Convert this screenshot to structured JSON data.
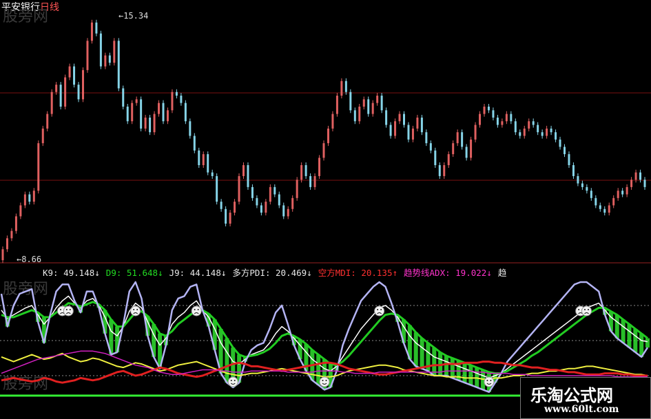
{
  "header": {
    "stock": "平安银行",
    "period": "日线"
  },
  "watermark": "股旁网",
  "price_labels": {
    "max": "15.34",
    "min": "8.66"
  },
  "indicators": [
    {
      "label": "K9: 49.148↓",
      "color": "#e8e8e8"
    },
    {
      "label": "D9: 51.648↓",
      "color": "#22dd22"
    },
    {
      "label": "J9: 44.148↓",
      "color": "#e8e8e8"
    },
    {
      "label": "多方PDI: 20.469↓",
      "color": "#e8e8e8"
    },
    {
      "label": "空方MDI: 20.135↑",
      "color": "#ff3030"
    },
    {
      "label": "趋势线ADX: 19.022↓",
      "color": "#ff33cc"
    },
    {
      "label": "趋",
      "color": "#e8e8e8"
    }
  ],
  "brand": {
    "name": "乐淘公式网",
    "url": "www.60lt.com"
  },
  "colors": {
    "up": "#e06060",
    "down": "#86d4e8",
    "grid": "#7a1010",
    "k": "#ffffff",
    "d": "#22cc22",
    "j": "#b4b4f4",
    "pdi": "#f0f040",
    "mdi": "#e02020",
    "adx": "#d020c0",
    "fill": "#33ee33"
  },
  "chart_data": [
    {
      "type": "candlestick",
      "title": "平安银行 日线",
      "ylim": [
        8.66,
        15.34
      ],
      "annotations": [
        "15.34",
        "8.66"
      ],
      "close": [
        8.9,
        9.2,
        9.4,
        9.8,
        10.1,
        10.4,
        10.2,
        10.5,
        11.8,
        12.2,
        12.6,
        13.2,
        13.4,
        12.8,
        13.6,
        13.9,
        13.4,
        13.0,
        13.8,
        14.6,
        15.1,
        14.8,
        13.9,
        14.2,
        14.0,
        14.6,
        13.3,
        12.8,
        12.4,
        12.9,
        13.0,
        12.2,
        12.5,
        12.1,
        12.6,
        12.9,
        12.4,
        12.7,
        13.2,
        13.1,
        12.9,
        12.4,
        12.0,
        11.6,
        11.2,
        11.5,
        11.0,
        10.9,
        10.2,
        10.0,
        9.6,
        9.9,
        10.2,
        10.9,
        11.2,
        10.6,
        10.3,
        10.1,
        9.9,
        10.2,
        10.6,
        10.4,
        10.1,
        9.8,
        10.0,
        10.3,
        10.8,
        11.2,
        10.9,
        10.6,
        10.9,
        11.4,
        11.8,
        12.2,
        12.6,
        13.1,
        13.5,
        13.2,
        12.7,
        12.4,
        12.8,
        13.0,
        12.6,
        12.9,
        13.1,
        12.7,
        12.3,
        12.0,
        12.4,
        12.6,
        12.3,
        11.9,
        12.2,
        12.5,
        12.1,
        11.8,
        11.6,
        11.2,
        10.9,
        11.2,
        11.5,
        11.8,
        12.1,
        11.7,
        11.4,
        11.9,
        12.3,
        12.6,
        12.8,
        12.7,
        12.5,
        12.3,
        12.4,
        12.6,
        12.4,
        12.1,
        12.0,
        12.2,
        12.4,
        12.3,
        12.1,
        12.0,
        12.2,
        12.1,
        11.9,
        11.7,
        11.5,
        11.2,
        10.9,
        10.7,
        10.6,
        10.5,
        10.3,
        10.1,
        10.0,
        9.9,
        10.1,
        10.3,
        10.5,
        10.4,
        10.6,
        10.8,
        11.0,
        10.8,
        10.6
      ]
    },
    {
      "type": "line",
      "series": [
        {
          "name": "K9",
          "values": [
            76,
            69,
            72,
            75,
            78,
            80,
            72,
            64,
            70,
            78,
            84,
            88,
            82,
            78,
            84,
            86,
            80,
            70,
            58,
            54,
            62,
            75,
            82,
            78,
            66,
            55,
            46,
            52,
            64,
            70,
            74,
            80,
            84,
            76,
            70,
            60,
            48,
            40,
            32,
            30,
            34,
            38,
            40,
            42,
            48,
            56,
            62,
            58,
            52,
            46,
            40,
            34,
            30,
            26,
            24,
            28,
            36,
            44,
            52,
            60,
            66,
            72,
            78,
            80,
            76,
            70,
            62,
            54,
            48,
            44,
            40,
            36,
            34,
            32,
            30,
            28,
            26,
            24,
            22,
            20,
            18,
            20,
            22,
            26,
            30,
            34,
            38,
            42,
            46,
            50,
            54,
            58,
            62,
            66,
            70,
            74,
            78,
            80,
            82,
            76,
            70,
            66,
            62,
            58,
            54,
            50,
            49
          ]
        },
        {
          "name": "D9",
          "values": [
            72,
            70,
            70,
            72,
            74,
            76,
            74,
            70,
            70,
            74,
            78,
            82,
            81,
            79,
            81,
            83,
            81,
            76,
            68,
            62,
            62,
            68,
            74,
            75,
            71,
            64,
            56,
            54,
            58,
            64,
            68,
            72,
            76,
            76,
            73,
            68,
            60,
            52,
            44,
            38,
            36,
            37,
            38,
            40,
            43,
            48,
            54,
            56,
            54,
            51,
            47,
            42,
            38,
            34,
            30,
            29,
            32,
            37,
            43,
            49,
            55,
            61,
            67,
            72,
            73,
            72,
            68,
            63,
            57,
            52,
            48,
            44,
            40,
            37,
            35,
            33,
            31,
            29,
            27,
            25,
            23,
            22,
            22,
            24,
            27,
            30,
            33,
            37,
            40,
            44,
            48,
            52,
            56,
            60,
            64,
            68,
            72,
            75,
            78,
            78,
            75,
            72,
            68,
            64,
            60,
            56,
            52
          ]
        },
        {
          "name": "J9",
          "values": [
            90,
            62,
            80,
            90,
            92,
            94,
            66,
            48,
            72,
            92,
            98,
            98,
            84,
            74,
            92,
            92,
            78,
            56,
            38,
            40,
            64,
            92,
            100,
            86,
            54,
            36,
            26,
            46,
            76,
            86,
            88,
            96,
            98,
            76,
            62,
            42,
            22,
            14,
            10,
            14,
            32,
            42,
            46,
            48,
            60,
            74,
            80,
            64,
            46,
            34,
            24,
            16,
            12,
            8,
            10,
            24,
            46,
            60,
            72,
            84,
            90,
            96,
            100,
            96,
            82,
            66,
            48,
            34,
            28,
            26,
            24,
            20,
            20,
            20,
            18,
            16,
            14,
            12,
            10,
            8,
            6,
            14,
            22,
            32,
            38,
            44,
            50,
            56,
            62,
            68,
            74,
            80,
            86,
            92,
            98,
            100,
            100,
            96,
            92,
            72,
            58,
            52,
            48,
            44,
            40,
            36,
            44
          ]
        },
        {
          "name": "PDI",
          "values": [
            36,
            34,
            32,
            34,
            36,
            38,
            36,
            34,
            35,
            37,
            39,
            36,
            34,
            32,
            33,
            35,
            34,
            32,
            30,
            28,
            27,
            29,
            31,
            30,
            28,
            26,
            24,
            25,
            27,
            29,
            30,
            31,
            32,
            30,
            28,
            26,
            24,
            22,
            21,
            20,
            21,
            22,
            22,
            23,
            24,
            25,
            26,
            25,
            24,
            23,
            22,
            21,
            20,
            19,
            19,
            20,
            22,
            24,
            25,
            26,
            27,
            28,
            29,
            29,
            28,
            27,
            25,
            24,
            23,
            22,
            21,
            20,
            20,
            19,
            19,
            19,
            18,
            18,
            18,
            17,
            17,
            18,
            18,
            19,
            20,
            20,
            21,
            22,
            22,
            23,
            24,
            24,
            25,
            26,
            26,
            27,
            28,
            28,
            27,
            26,
            25,
            24,
            23,
            22,
            21,
            21,
            20
          ]
        },
        {
          "name": "MDI",
          "values": [
            16,
            17,
            18,
            17,
            16,
            15,
            16,
            18,
            17,
            15,
            14,
            15,
            16,
            18,
            17,
            16,
            17,
            19,
            21,
            23,
            24,
            22,
            20,
            21,
            23,
            25,
            27,
            26,
            24,
            22,
            21,
            20,
            19,
            20,
            22,
            24,
            26,
            28,
            30,
            31,
            30,
            28,
            28,
            27,
            26,
            25,
            24,
            25,
            26,
            27,
            28,
            29,
            30,
            31,
            31,
            30,
            28,
            26,
            25,
            24,
            23,
            22,
            21,
            21,
            22,
            23,
            24,
            25,
            26,
            27,
            28,
            29,
            29,
            30,
            30,
            30,
            31,
            31,
            31,
            32,
            32,
            31,
            31,
            30,
            29,
            29,
            28,
            27,
            27,
            26,
            25,
            25,
            24,
            23,
            23,
            22,
            21,
            21,
            21,
            22,
            22,
            22,
            21,
            21,
            20,
            20,
            20
          ]
        },
        {
          "name": "ADX",
          "values": [
            22,
            24,
            26,
            28,
            30,
            32,
            34,
            35,
            36,
            37,
            38,
            39,
            40,
            41,
            41,
            41,
            40,
            39,
            37,
            35,
            33,
            31,
            29,
            28,
            27,
            25,
            23,
            22,
            21,
            21,
            22,
            23,
            24,
            25,
            25,
            25,
            24,
            24,
            23,
            23,
            23,
            24,
            24,
            24,
            24,
            24,
            24,
            23,
            23,
            23,
            23,
            23,
            24,
            24,
            24,
            24,
            23,
            23,
            22,
            22,
            22,
            22,
            23,
            23,
            23,
            23,
            23,
            23,
            23,
            23,
            23,
            23,
            23,
            24,
            24,
            24,
            24,
            24,
            23,
            23,
            22,
            22,
            22,
            22,
            21,
            21,
            21,
            20,
            20,
            20,
            20,
            20,
            20,
            20,
            20,
            20,
            20,
            20,
            20,
            20,
            20,
            19,
            19,
            19,
            19,
            19,
            19
          ]
        }
      ]
    }
  ]
}
